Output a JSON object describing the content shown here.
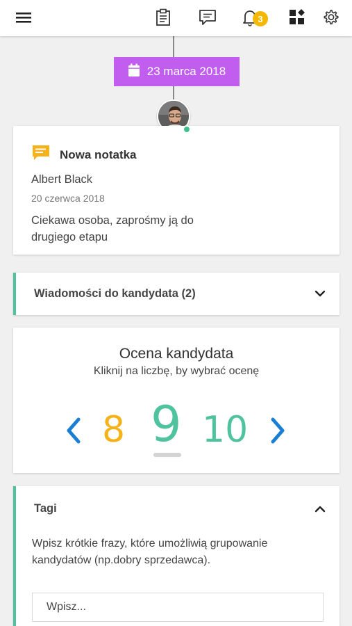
{
  "topbar": {
    "notification_count": "3"
  },
  "timeline": {
    "date": "23 marca 2018",
    "accent_color": "#c15ef0"
  },
  "note": {
    "title": "Nowa notatka",
    "author": "Albert Black",
    "date": "20 czerwca 2018",
    "body": "Ciekawa osoba, zaprośmy ją do drugiego etapu"
  },
  "messages": {
    "label": "Wiadomości do kandydata (2)"
  },
  "rating": {
    "title": "Ocena kandydata",
    "subtitle": "Kliknij na liczbę, by wybrać ocenę",
    "options": [
      "8",
      "9",
      "10"
    ],
    "selected": "9"
  },
  "tags": {
    "title": "Tagi",
    "description": "Wpisz krótkie frazy, które umożliwią grupowanie kandydatów (np.dobry sprzedawca).",
    "input_placeholder": "Wpisz..."
  },
  "colors": {
    "green": "#4fc39d",
    "orange": "#f5b21b",
    "blue": "#1a7fd4",
    "badge": "#f5b800"
  }
}
